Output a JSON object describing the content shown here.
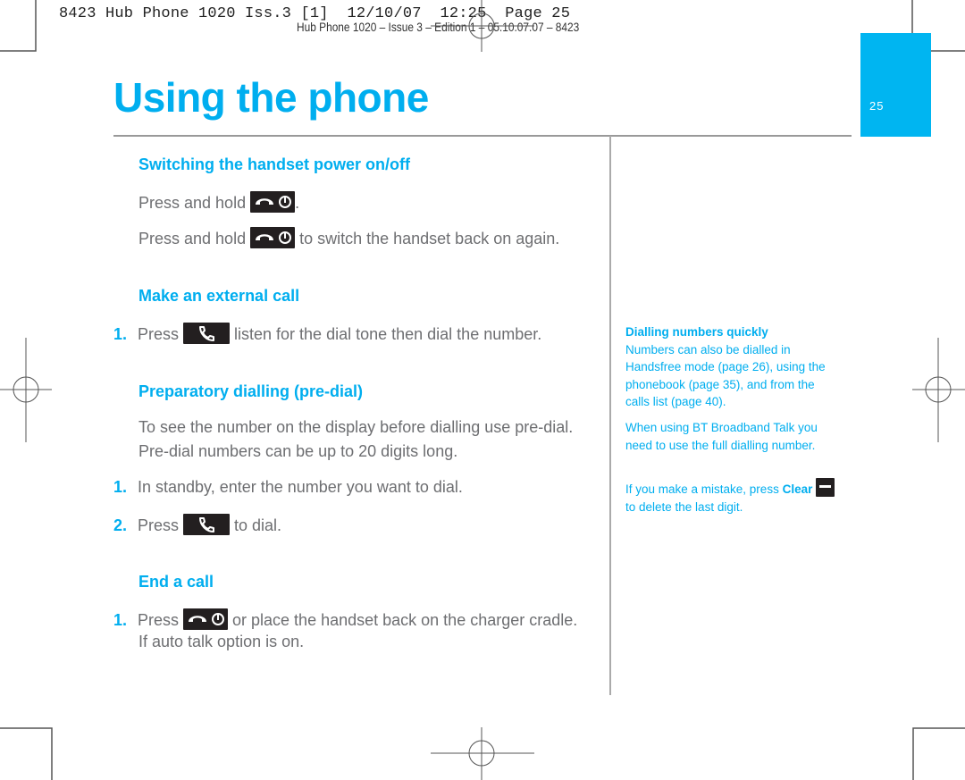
{
  "print_slug": "8423 Hub Phone 1020 Iss.3 [1]  12/10/07  12:25  Page 25",
  "print_subslug": "Hub Phone 1020 – Issue 3 – Edition 1 – 05.10.07.07 – 8423",
  "page": {
    "title": "Using the phone",
    "page_number": "25",
    "accent_color": "#00aeef"
  },
  "sections": {
    "power": {
      "heading": "Switching the handset power on/off",
      "line1_before": "Press and hold ",
      "line1_after": ".",
      "line2_before": "Press and hold ",
      "line2_after": " to switch the handset back on again."
    },
    "external_call": {
      "heading": "Make an external call",
      "steps": [
        {
          "num": "1.",
          "before": "Press ",
          "after": " listen for the dial tone then dial the number."
        }
      ]
    },
    "predial": {
      "heading": "Preparatory dialling (pre-dial)",
      "intro_line1": "To see the number on the display before dialling use pre-dial.",
      "intro_line2": "Pre-dial numbers can be up to 20 digits long.",
      "steps": [
        {
          "num": "1.",
          "text": "In standby, enter the number you want to dial."
        },
        {
          "num": "2.",
          "before": "Press ",
          "after": " to dial."
        }
      ]
    },
    "end_call": {
      "heading": "End a call",
      "steps": [
        {
          "num": "1.",
          "before": "Press ",
          "after": " or place the handset back on the charger cradle.",
          "line2": "If auto talk option is on."
        }
      ]
    }
  },
  "sidebar": {
    "tip_heading": "Dialling numbers quickly",
    "tip_lines": [
      "Numbers can also be dialled in",
      "Handsfree mode (page 26), using the",
      "phonebook (page 35), and from the",
      "calls list (page 40)."
    ],
    "broadband_lines": [
      "When using BT Broadband Talk you",
      "need to use the full dialling number."
    ],
    "mistake_before": "If you make a mistake, press ",
    "mistake_bold": "Clear",
    "mistake_line2": "to delete the last digit."
  },
  "icons": {
    "end_power_key": "end-call-power-icon",
    "talk_key": "talk-phone-icon",
    "clear_key": "clear-minus-icon"
  }
}
